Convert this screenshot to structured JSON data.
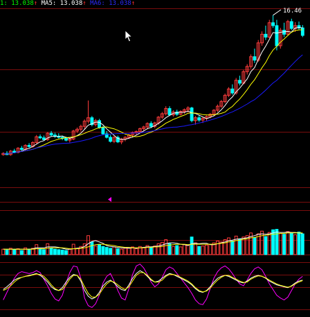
{
  "legend": {
    "items": [
      {
        "label": "1:",
        "value": "13.038",
        "arrow": "↑",
        "color": "#00ff00"
      },
      {
        "label": "MA5:",
        "value": "13.038",
        "arrow": "↑",
        "color": "#ffffff"
      },
      {
        "label": "MA6:",
        "value": "13.038",
        "arrow": "↑",
        "color": "#2b2bff"
      }
    ]
  },
  "colors": {
    "background": "#000000",
    "grid": "#7a0d0d",
    "up": "#ff3c3c",
    "down": "#00ffff",
    "ma_white": "#ffffff",
    "ma_yellow": "#ffff00",
    "ma_blue": "#1a1aff",
    "osc_magenta": "#ff00ff",
    "osc_yellow": "#ffff00",
    "osc_white": "#ffffff",
    "marker": "#ff00ff"
  },
  "chart_data": {
    "type": "candlestick",
    "high_label": "16.46",
    "price_range": [
      11.4,
      16.7
    ],
    "volume_range": [
      0,
      100
    ],
    "osc_range": [
      0,
      100
    ],
    "candles": [
      [
        11.62,
        11.7,
        11.58,
        11.66
      ],
      [
        11.66,
        11.74,
        11.6,
        11.62
      ],
      [
        11.62,
        11.78,
        11.58,
        11.74
      ],
      [
        11.74,
        11.82,
        11.68,
        11.7
      ],
      [
        11.7,
        11.88,
        11.66,
        11.84
      ],
      [
        11.84,
        11.92,
        11.76,
        11.8
      ],
      [
        11.8,
        11.98,
        11.76,
        11.94
      ],
      [
        11.94,
        12.02,
        11.86,
        11.9
      ],
      [
        11.9,
        12.08,
        11.86,
        12.04
      ],
      [
        12.04,
        12.3,
        12.0,
        12.24
      ],
      [
        12.24,
        12.32,
        12.16,
        12.2
      ],
      [
        12.2,
        12.28,
        12.1,
        12.14
      ],
      [
        12.14,
        12.4,
        12.1,
        12.36
      ],
      [
        12.36,
        12.44,
        12.26,
        12.3
      ],
      [
        12.3,
        12.38,
        12.2,
        12.26
      ],
      [
        12.26,
        12.36,
        12.18,
        12.22
      ],
      [
        12.22,
        12.28,
        12.12,
        12.18
      ],
      [
        12.18,
        12.24,
        12.08,
        12.12
      ],
      [
        12.12,
        12.2,
        12.04,
        12.16
      ],
      [
        12.16,
        12.48,
        12.12,
        12.44
      ],
      [
        12.44,
        12.56,
        12.38,
        12.5
      ],
      [
        12.5,
        12.66,
        12.42,
        12.6
      ],
      [
        12.6,
        12.84,
        12.5,
        12.78
      ],
      [
        12.78,
        13.5,
        12.7,
        12.9
      ],
      [
        12.9,
        12.96,
        12.6,
        12.66
      ],
      [
        12.66,
        12.86,
        12.6,
        12.8
      ],
      [
        12.8,
        12.86,
        12.52,
        12.56
      ],
      [
        12.56,
        12.62,
        12.3,
        12.34
      ],
      [
        12.34,
        12.44,
        12.18,
        12.22
      ],
      [
        12.22,
        12.3,
        12.04,
        12.08
      ],
      [
        12.08,
        12.26,
        12.02,
        12.22
      ],
      [
        12.22,
        12.28,
        12.02,
        12.06
      ],
      [
        12.06,
        12.2,
        11.98,
        12.16
      ],
      [
        12.16,
        12.26,
        12.08,
        12.22
      ],
      [
        12.22,
        12.34,
        12.16,
        12.3
      ],
      [
        12.3,
        12.42,
        12.24,
        12.38
      ],
      [
        12.38,
        12.46,
        12.3,
        12.42
      ],
      [
        12.42,
        12.56,
        12.36,
        12.52
      ],
      [
        12.52,
        12.62,
        12.44,
        12.58
      ],
      [
        12.58,
        12.74,
        12.5,
        12.7
      ],
      [
        12.7,
        12.78,
        12.54,
        12.6
      ],
      [
        12.6,
        12.76,
        12.54,
        12.72
      ],
      [
        12.72,
        12.96,
        12.66,
        12.92
      ],
      [
        12.92,
        13.1,
        12.86,
        13.04
      ],
      [
        13.04,
        13.3,
        12.98,
        13.22
      ],
      [
        13.22,
        13.3,
        12.96,
        13.0
      ],
      [
        13.0,
        13.16,
        12.94,
        13.1
      ],
      [
        13.1,
        13.18,
        12.96,
        13.02
      ],
      [
        13.02,
        13.16,
        12.98,
        13.12
      ],
      [
        13.12,
        13.22,
        13.04,
        13.18
      ],
      [
        13.18,
        13.3,
        13.08,
        13.24
      ],
      [
        13.24,
        13.28,
        12.74,
        12.8
      ],
      [
        12.8,
        12.96,
        12.66,
        12.9
      ],
      [
        12.9,
        12.98,
        12.76,
        12.82
      ],
      [
        12.82,
        12.92,
        12.72,
        12.88
      ],
      [
        12.88,
        12.98,
        12.8,
        12.94
      ],
      [
        12.94,
        13.06,
        12.88,
        13.02
      ],
      [
        13.02,
        13.2,
        12.96,
        13.16
      ],
      [
        13.16,
        13.36,
        13.1,
        13.3
      ],
      [
        13.3,
        13.52,
        13.24,
        13.46
      ],
      [
        13.46,
        13.74,
        13.4,
        13.68
      ],
      [
        13.68,
        13.96,
        13.62,
        13.9
      ],
      [
        13.9,
        14.06,
        13.7,
        13.76
      ],
      [
        13.76,
        14.28,
        13.7,
        14.2
      ],
      [
        14.2,
        14.36,
        14.02,
        14.1
      ],
      [
        14.1,
        14.56,
        14.06,
        14.5
      ],
      [
        14.5,
        14.76,
        14.4,
        14.68
      ],
      [
        14.68,
        15.1,
        14.6,
        15.02
      ],
      [
        15.02,
        15.3,
        14.8,
        14.9
      ],
      [
        14.9,
        15.6,
        14.84,
        15.5
      ],
      [
        15.5,
        15.9,
        15.4,
        15.8
      ],
      [
        15.8,
        16.1,
        15.6,
        15.7
      ],
      [
        15.7,
        16.3,
        15.66,
        16.2
      ],
      [
        16.2,
        16.46,
        16.02,
        16.1
      ],
      [
        16.1,
        16.3,
        15.24,
        15.4
      ],
      [
        15.4,
        16.02,
        15.3,
        15.94
      ],
      [
        15.94,
        16.2,
        15.7,
        15.8
      ],
      [
        15.8,
        16.3,
        15.74,
        16.24
      ],
      [
        16.24,
        16.34,
        15.94,
        16.0
      ],
      [
        16.0,
        16.22,
        15.88,
        16.1
      ],
      [
        16.1,
        16.24,
        15.96,
        16.02
      ],
      [
        16.02,
        16.12,
        15.7,
        15.76
      ]
    ],
    "volume": [
      12,
      10,
      14,
      11,
      13,
      9,
      15,
      12,
      14,
      22,
      13,
      11,
      24,
      14,
      12,
      11,
      10,
      9,
      12,
      23,
      14,
      18,
      24,
      42,
      28,
      19,
      22,
      18,
      16,
      14,
      17,
      13,
      12,
      14,
      15,
      17,
      13,
      18,
      16,
      20,
      16,
      19,
      24,
      27,
      33,
      24,
      18,
      20,
      17,
      22,
      21,
      39,
      26,
      18,
      19,
      21,
      23,
      26,
      30,
      28,
      33,
      37,
      30,
      41,
      34,
      39,
      42,
      48,
      38,
      46,
      52,
      40,
      49,
      55,
      56,
      47,
      45,
      51,
      48,
      44,
      50,
      46
    ],
    "volume_ma": [
      [
        12,
        12,
        12,
        12,
        12,
        12,
        12,
        12,
        13,
        15,
        15,
        15,
        17,
        17,
        17,
        16,
        14,
        12,
        12,
        13,
        14,
        15,
        18,
        24,
        29,
        31,
        28,
        25,
        20,
        18,
        17,
        16,
        15,
        15,
        14,
        15,
        14,
        15,
        16,
        17,
        17,
        18,
        19,
        21,
        24,
        26,
        26,
        25,
        23,
        22,
        20,
        24,
        25,
        24,
        25,
        25,
        22,
        22,
        24,
        26,
        28,
        31,
        32,
        34,
        35,
        36,
        37,
        40,
        42,
        45,
        46,
        45,
        46,
        48,
        50,
        49,
        49,
        50,
        49,
        49,
        48,
        47
      ],
      [
        12,
        12,
        12,
        12,
        12,
        12,
        12,
        12,
        12,
        13,
        13,
        13,
        14,
        15,
        15,
        15,
        15,
        14,
        13,
        13,
        13,
        14,
        15,
        17,
        20,
        22,
        23,
        23,
        22,
        21,
        20,
        18,
        17,
        16,
        16,
        15,
        15,
        15,
        15,
        16,
        16,
        17,
        17,
        18,
        20,
        21,
        22,
        23,
        23,
        23,
        22,
        23,
        23,
        23,
        23,
        23,
        23,
        23,
        24,
        25,
        26,
        28,
        29,
        31,
        32,
        34,
        35,
        37,
        38,
        40,
        42,
        43,
        44,
        45,
        46,
        47,
        47,
        48,
        48,
        48,
        48,
        48
      ]
    ],
    "osc": [
      [
        42,
        48,
        55,
        62,
        66,
        68,
        70,
        72,
        74,
        76,
        72,
        66,
        58,
        48,
        42,
        40,
        46,
        58,
        68,
        74,
        72,
        60,
        40,
        28,
        22,
        26,
        36,
        50,
        58,
        62,
        56,
        48,
        42,
        40,
        52,
        66,
        76,
        82,
        78,
        70,
        62,
        58,
        60,
        66,
        72,
        76,
        74,
        70,
        66,
        62,
        58,
        52,
        44,
        38,
        36,
        40,
        48,
        58,
        66,
        70,
        72,
        70,
        66,
        62,
        58,
        56,
        60,
        66,
        70,
        72,
        70,
        66,
        60,
        56,
        52,
        50,
        48,
        46,
        50,
        56,
        60,
        62
      ],
      [
        20,
        36,
        52,
        66,
        76,
        80,
        78,
        76,
        78,
        82,
        78,
        64,
        50,
        34,
        22,
        18,
        30,
        56,
        78,
        92,
        90,
        66,
        24,
        8,
        4,
        12,
        30,
        56,
        70,
        76,
        60,
        40,
        24,
        20,
        44,
        74,
        92,
        96,
        88,
        74,
        58,
        48,
        54,
        68,
        84,
        90,
        86,
        76,
        66,
        56,
        46,
        34,
        20,
        12,
        10,
        22,
        44,
        66,
        80,
        88,
        92,
        86,
        76,
        64,
        54,
        50,
        62,
        76,
        86,
        90,
        84,
        70,
        54,
        42,
        30,
        24,
        20,
        26,
        40,
        54,
        64,
        70
      ],
      [
        40,
        44,
        50,
        58,
        64,
        68,
        70,
        71,
        73,
        75,
        74,
        70,
        62,
        52,
        44,
        40,
        42,
        52,
        64,
        72,
        72,
        64,
        48,
        34,
        26,
        26,
        32,
        44,
        54,
        60,
        58,
        52,
        46,
        42,
        48,
        60,
        72,
        78,
        78,
        72,
        64,
        58,
        58,
        62,
        70,
        74,
        74,
        72,
        68,
        64,
        60,
        54,
        46,
        40,
        37,
        39,
        45,
        54,
        62,
        68,
        72,
        72,
        68,
        64,
        60,
        57,
        58,
        64,
        68,
        71,
        70,
        67,
        62,
        58,
        54,
        51,
        49,
        47,
        49,
        54,
        58,
        61
      ]
    ]
  }
}
